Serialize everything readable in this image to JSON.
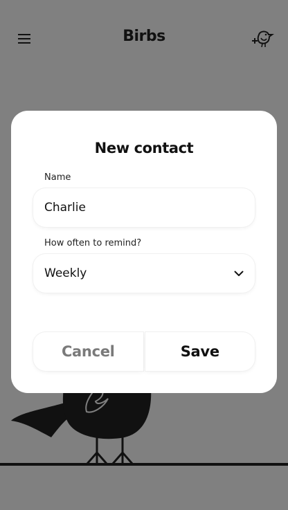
{
  "header": {
    "title": "Birbs",
    "menu_icon": "hamburger-menu-icon",
    "add_icon": "add-bird-icon"
  },
  "dialog": {
    "title": "New contact",
    "name_label": "Name",
    "name_value": "Charlie",
    "remind_label": "How often to remind?",
    "remind_value": "Weekly",
    "cancel_label": "Cancel",
    "save_label": "Save"
  },
  "colors": {
    "backdrop": "#808080",
    "surface": "#ffffff",
    "text": "#111111",
    "muted_button": "#7a7a7a"
  }
}
